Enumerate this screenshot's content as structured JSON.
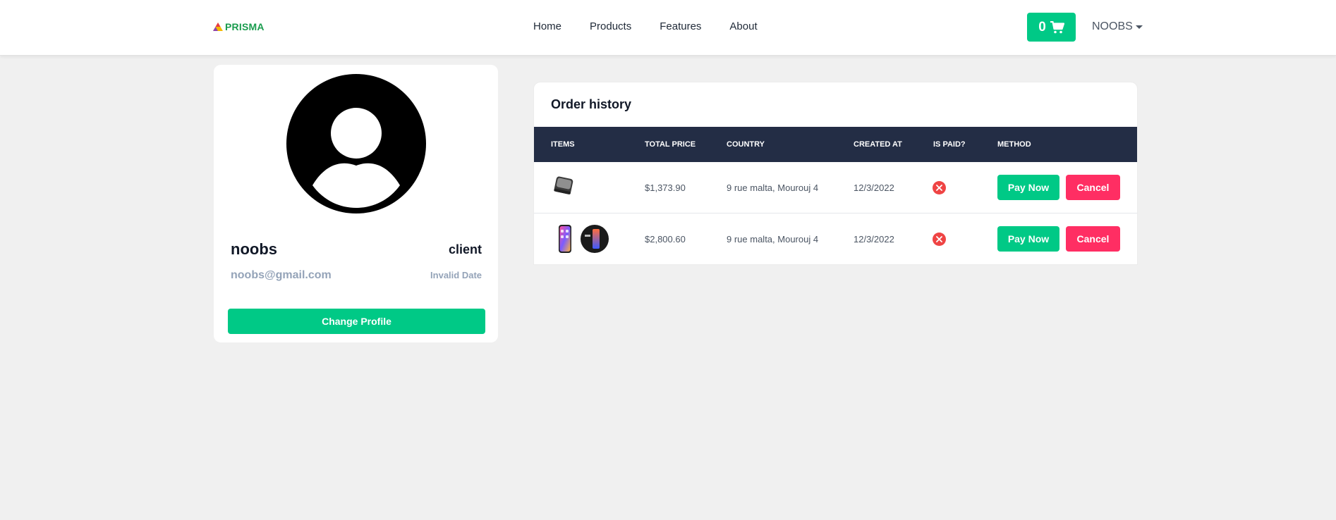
{
  "nav": {
    "logo_text": "PRISMA",
    "links": [
      "Home",
      "Products",
      "Features",
      "About"
    ],
    "cart_count": "0",
    "user_label": "NOOBS"
  },
  "profile": {
    "name": "noobs",
    "role": "client",
    "email": "noobs@gmail.com",
    "date": "Invalid Date",
    "change_button": "Change Profile"
  },
  "orders": {
    "title": "Order history",
    "columns": [
      "ITEMS",
      "TOTAL PRICE",
      "COUNTRY",
      "CREATED AT",
      "IS PAID?",
      "METHOD"
    ],
    "rows": [
      {
        "items": [
          "device-thumbnail"
        ],
        "total_price": "$1,373.90",
        "country": "9 rue malta, Mourouj 4",
        "created_at": "12/3/2022",
        "pay_label": "Pay Now",
        "cancel_label": "Cancel"
      },
      {
        "items": [
          "smartphone-thumbnail",
          "phone-promo-thumbnail"
        ],
        "total_price": "$2,800.60",
        "country": "9 rue malta, Mourouj 4",
        "created_at": "12/3/2022",
        "pay_label": "Pay Now",
        "cancel_label": "Cancel"
      }
    ]
  },
  "colors": {
    "accent": "#00c986",
    "danger": "#ff2e63",
    "table_header": "#232d45",
    "unpaid_icon": "#ef4444"
  }
}
